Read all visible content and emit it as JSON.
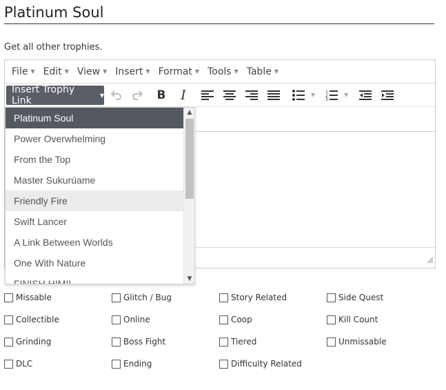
{
  "page": {
    "title": "Platinum Soul",
    "description": "Get all other trophies."
  },
  "menubar": {
    "items": [
      {
        "label": "File"
      },
      {
        "label": "Edit"
      },
      {
        "label": "View"
      },
      {
        "label": "Insert"
      },
      {
        "label": "Format"
      },
      {
        "label": "Tools"
      },
      {
        "label": "Table"
      }
    ]
  },
  "toolbar": {
    "insert_trophy_link": "Insert Trophy Link",
    "icons": [
      "undo-icon",
      "redo-icon",
      "bold-icon",
      "italic-icon",
      "align-left-icon",
      "align-center-icon",
      "align-right-icon",
      "align-justify-icon",
      "bullet-list-icon",
      "numbered-list-icon",
      "outdent-icon",
      "indent-icon"
    ]
  },
  "dropdown": {
    "items": [
      {
        "label": "Platinum Soul",
        "state": "selected"
      },
      {
        "label": "Power Overwhelming"
      },
      {
        "label": "From the Top"
      },
      {
        "label": "Master Sukurúame"
      },
      {
        "label": "Friendly Fire",
        "state": "hover"
      },
      {
        "label": "Swift Lancer"
      },
      {
        "label": "A Link Between Worlds"
      },
      {
        "label": "One With Nature"
      },
      {
        "label": "FINISH HIM!!"
      }
    ]
  },
  "checkboxes": {
    "items": [
      {
        "label": "Missable",
        "checked": false
      },
      {
        "label": "Glitch / Bug",
        "checked": false
      },
      {
        "label": "Story Related",
        "checked": false
      },
      {
        "label": "Side Quest",
        "checked": false
      },
      {
        "label": "Collectible",
        "checked": false
      },
      {
        "label": "Online",
        "checked": false
      },
      {
        "label": "Coop",
        "checked": false
      },
      {
        "label": "Kill Count",
        "checked": false
      },
      {
        "label": "Grinding",
        "checked": false
      },
      {
        "label": "Boss Fight",
        "checked": false
      },
      {
        "label": "Tiered",
        "checked": false
      },
      {
        "label": "Unmissable",
        "checked": false
      },
      {
        "label": "DLC",
        "checked": false
      },
      {
        "label": "Ending",
        "checked": false
      },
      {
        "label": "Difficulty Related",
        "checked": false
      }
    ]
  },
  "colors": {
    "button_bg": "#5a5e66",
    "selected_bg": "#545861",
    "hover_bg": "#ececec"
  }
}
